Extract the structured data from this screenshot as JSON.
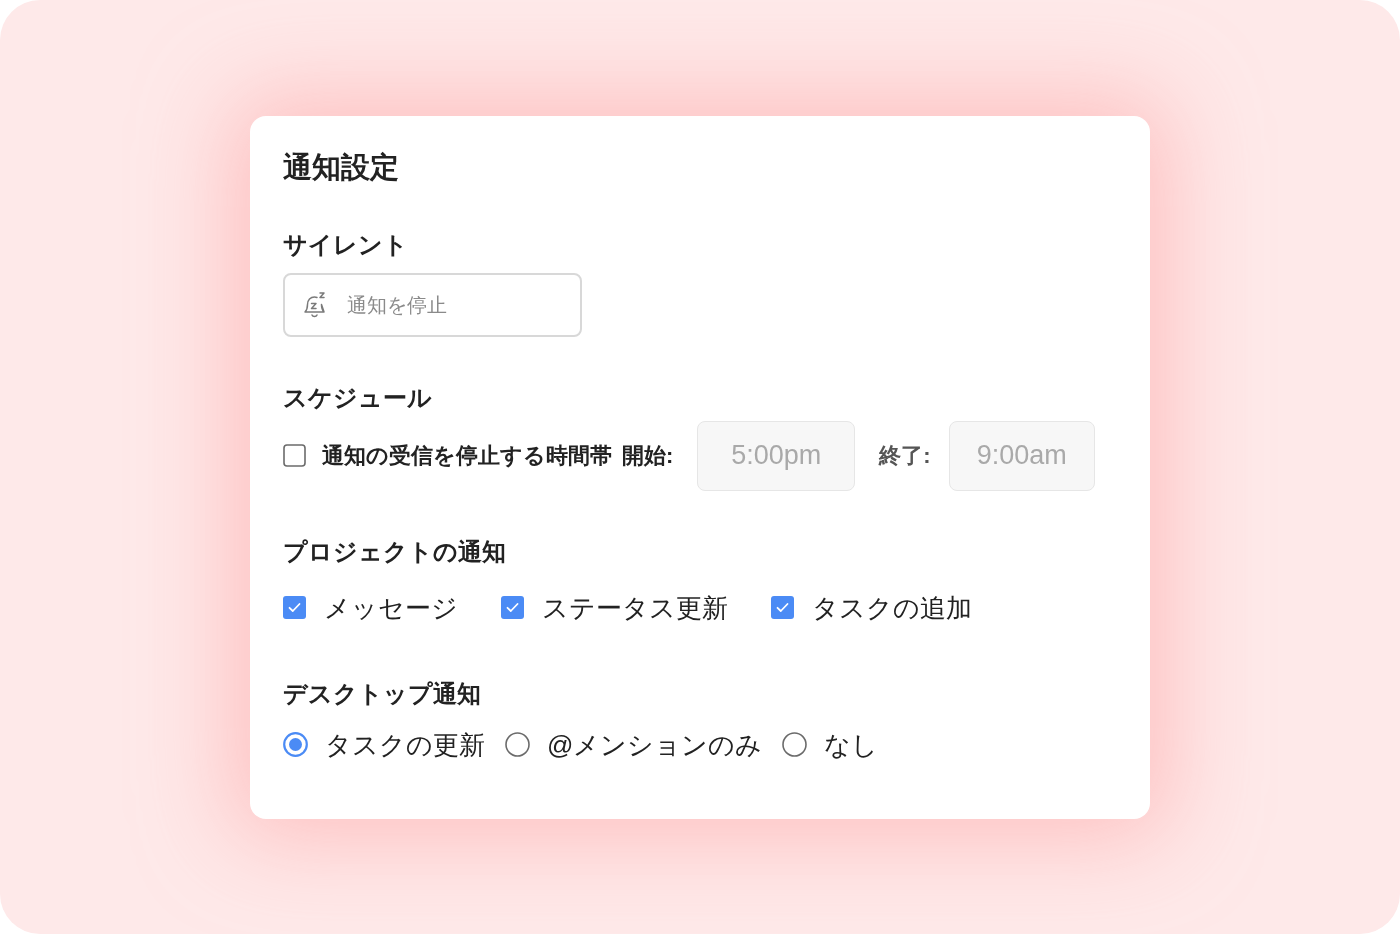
{
  "dialog": {
    "title": "通知設定"
  },
  "silent": {
    "heading": "サイレント",
    "button": "通知を停止"
  },
  "schedule": {
    "heading": "スケジュール",
    "checkbox": {
      "label": "通知の受信を停止する時間帯",
      "checked": false
    },
    "start_label": "開始:",
    "start_time": {
      "value": "5:00pm",
      "disabled": true
    },
    "end_label": "終了:",
    "end_time": {
      "value": "9:00am",
      "disabled": true
    }
  },
  "project_notifications": {
    "heading": "プロジェクトの通知",
    "options": [
      {
        "label": "メッセージ",
        "checked": true
      },
      {
        "label": "ステータス更新",
        "checked": true
      },
      {
        "label": "タスクの追加",
        "checked": true
      }
    ]
  },
  "desktop_notifications": {
    "heading": "デスクトップ通知",
    "options": [
      {
        "label": "タスクの更新",
        "selected": true
      },
      {
        "label": "@メンションのみ",
        "selected": false
      },
      {
        "label": "なし",
        "selected": false
      }
    ]
  }
}
